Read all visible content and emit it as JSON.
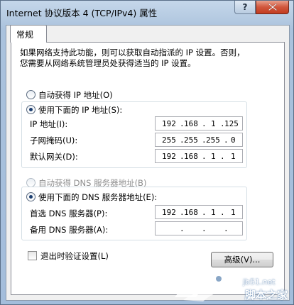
{
  "window": {
    "title": "Internet 协议版本 4 (TCP/IPv4) 属性",
    "help_label": "?"
  },
  "tab": {
    "label": "常规"
  },
  "description": {
    "line1": "如果网络支持此功能，则可以获取自动指派的 IP 设置。否则，",
    "line2": "您需要从网络系统管理员处获得适当的 IP 设置。"
  },
  "ip_section": {
    "auto_option": "自动获得 IP 地址(O)",
    "auto_selected": false,
    "manual_option": "使用下面的 IP 地址(S):",
    "manual_selected": true,
    "fields": [
      {
        "label": "IP 地址(I):",
        "octets": [
          "192",
          "168",
          "1",
          "125"
        ]
      },
      {
        "label": "子网掩码(U):",
        "octets": [
          "255",
          "255",
          "255",
          "0"
        ]
      },
      {
        "label": "默认网关(D):",
        "octets": [
          "192",
          "168",
          "1",
          "1"
        ]
      }
    ]
  },
  "dns_section": {
    "auto_option": "自动获得 DNS 服务器地址(B)",
    "auto_enabled": false,
    "manual_option": "使用下面的 DNS 服务器地址(E):",
    "manual_selected": true,
    "fields": [
      {
        "label": "首选 DNS 服务器(P):",
        "octets": [
          "192",
          "168",
          "1",
          "1"
        ]
      },
      {
        "label": "备用 DNS 服务器(A):",
        "octets": [
          "",
          "",
          "",
          ""
        ]
      }
    ]
  },
  "validate_on_exit": {
    "label": "退出时验证设置(L)",
    "checked": false
  },
  "advanced_button": {
    "label": "高级(V)..."
  },
  "watermark": {
    "site": "jb51.net",
    "name": "脚本之家"
  },
  "colors": {
    "close_button": "#c33b1f",
    "title_bar": "#b6cbe2",
    "radio_dot": "#1c3e70"
  }
}
